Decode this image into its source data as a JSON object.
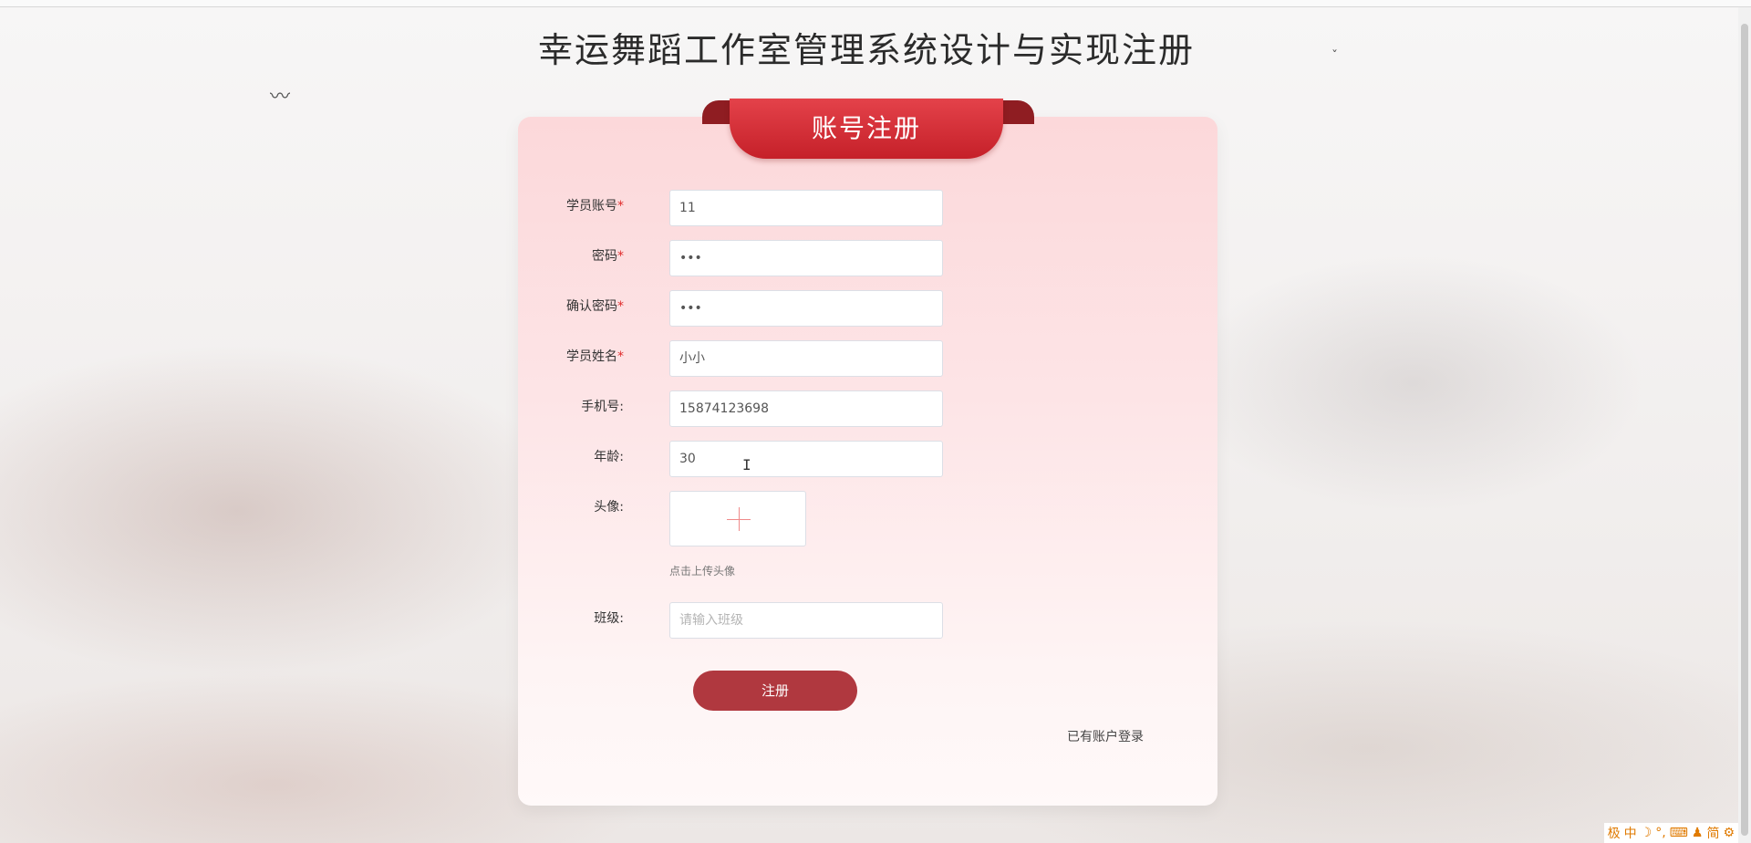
{
  "page": {
    "title": "幸运舞蹈工作室管理系统设计与实现注册"
  },
  "card": {
    "ribbon_title": "账号注册"
  },
  "form": {
    "account": {
      "label": "学员账号",
      "required": "*",
      "value": "11"
    },
    "password": {
      "label": "密码",
      "required": "*",
      "value": "•••"
    },
    "confirm_password": {
      "label": "确认密码",
      "required": "*",
      "value": "•••"
    },
    "name": {
      "label": "学员姓名",
      "required": "*",
      "value": "小小"
    },
    "phone": {
      "label": "手机号:",
      "value": "15874123698"
    },
    "age": {
      "label": "年龄:",
      "value": "30"
    },
    "avatar": {
      "label": "头像:",
      "hint": "点击上传头像"
    },
    "class": {
      "label": "班级:",
      "placeholder": "请输入班级"
    }
  },
  "actions": {
    "register_label": "注册",
    "login_link": "已有账户登录"
  },
  "ime": {
    "items": [
      "极",
      "中",
      "☽",
      "°,",
      "⌨",
      "♟",
      "简",
      "⚙"
    ]
  },
  "colors": {
    "accent": "#c52029",
    "button": "#b0383f"
  }
}
